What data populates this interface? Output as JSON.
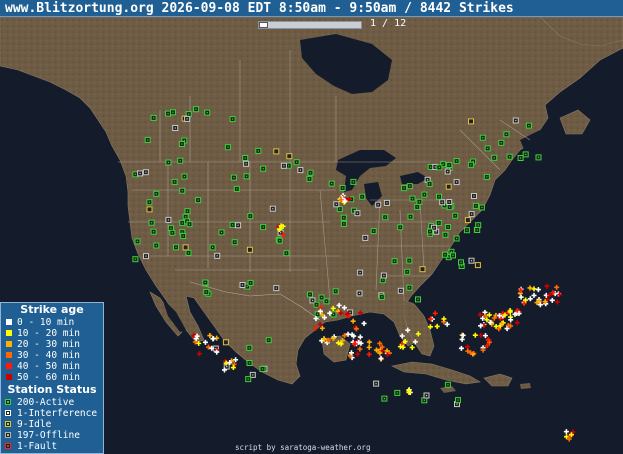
{
  "header": {
    "title": "www.Blitzortung.org 2026-09-08 EDT 8:50am - 9:50am / 8442 Strikes"
  },
  "pager": {
    "label": "1 / 12",
    "current": 1,
    "total": 12
  },
  "legend": {
    "strike_title": "Strike age",
    "strike_ages": [
      {
        "label": "0 - 10 min",
        "color": "#ffffff"
      },
      {
        "label": "10 - 20 min",
        "color": "#ffff00"
      },
      {
        "label": "20 - 30 min",
        "color": "#ffb000"
      },
      {
        "label": "30 - 40 min",
        "color": "#ff6a00"
      },
      {
        "label": "40 - 50 min",
        "color": "#ff1a00"
      },
      {
        "label": "50 - 60 min",
        "color": "#c80000"
      }
    ],
    "station_title": "Station Status",
    "station_status": [
      {
        "label": "200-Active",
        "color": "#3cd23c"
      },
      {
        "label": "1-Interference",
        "color": "#ffffff"
      },
      {
        "label": "9-Idle",
        "color": "#e0c040"
      },
      {
        "label": "197-Offline",
        "color": "#b0b0b0"
      },
      {
        "label": "1-Fault",
        "color": "#ff2020"
      }
    ]
  },
  "credit": "script by saratoga-weather.org",
  "colors": {
    "ocean": "#141c2c",
    "land": "#6b5a44",
    "border": "#a39b91",
    "header": "#1f5f93"
  }
}
